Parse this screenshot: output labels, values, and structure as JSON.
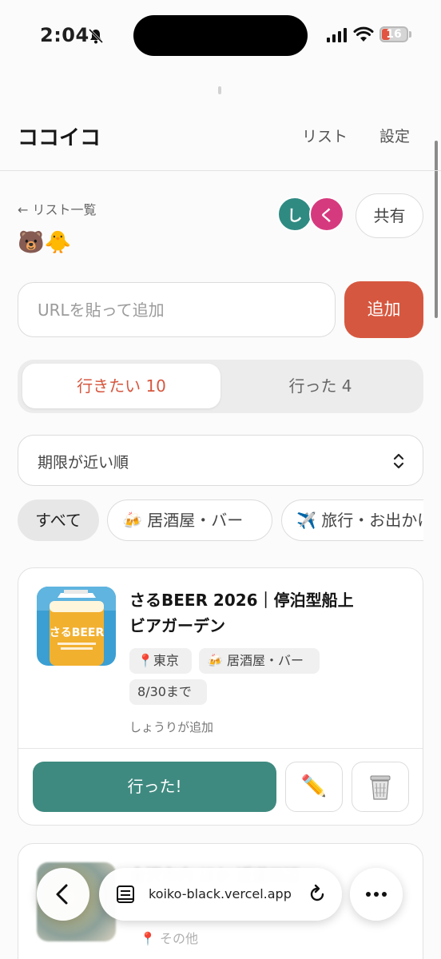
{
  "status_bar": {
    "time": "2:04",
    "battery": "16"
  },
  "header": {
    "brand": "ココイコ",
    "nav_list": "リスト",
    "nav_settings": "設定"
  },
  "list": {
    "back_link": "← リスト一覧",
    "emojis": "🐻🐥",
    "members": [
      "し",
      "く"
    ],
    "share_label": "共有"
  },
  "add": {
    "placeholder": "URLを貼って追加",
    "button": "追加"
  },
  "tabs": {
    "want": "行きたい 10",
    "went": "行った 4"
  },
  "sort": {
    "selected": "期限が近い順"
  },
  "filters": {
    "all": "すべて",
    "izakaya": "🍻 居酒屋・バー",
    "travel": "✈️ 旅行・お出かけ"
  },
  "card": {
    "thumb_text": "さるBEER",
    "title": "さるBEER 2026｜停泊型船上ビアガーデン",
    "location": "📍東京",
    "category": "🍻 居酒屋・バー",
    "deadline": "8/30まで",
    "added_by": "しょうりが追加",
    "went_button": "行った!",
    "edit_icon": "✏️"
  },
  "card2": {
    "title": "金沢市内 ほか 近道四辺",
    "location": "📍 その他"
  },
  "browser": {
    "url": "koiko-black.vercel.app"
  },
  "colors": {
    "accent": "#d6573f",
    "primary": "#3f8a80",
    "avatar1": "#2f8a82",
    "avatar2": "#d63a7e"
  }
}
